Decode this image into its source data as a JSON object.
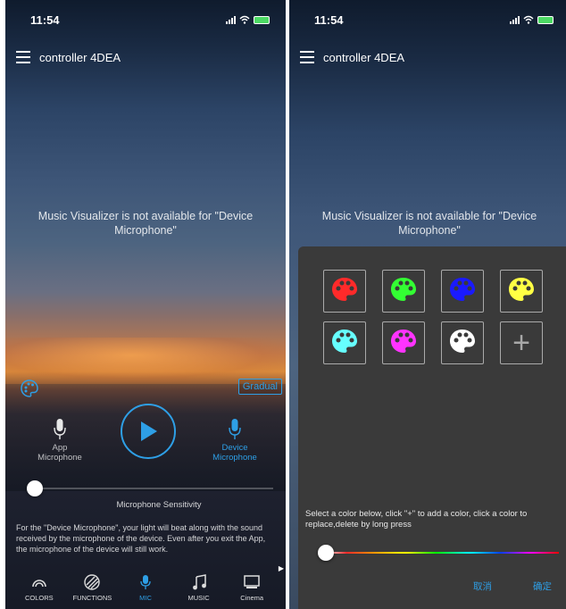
{
  "left": {
    "status": {
      "time": "11:54"
    },
    "title": "controller 4DEA",
    "notice": "Music Visualizer is not available for \"Device Microphone\"",
    "gradual_label": "Gradual",
    "app_mic": {
      "line1": "App",
      "line2": "Microphone"
    },
    "device_mic": {
      "line1": "Device",
      "line2": "Microphone"
    },
    "sensitivity_label": "Microphone Sensitivity",
    "sensitivity_value": 0,
    "explanation": "For the \"Device Microphone\", your light will beat along with the sound received by the microphone of the device. Even after you exit the App, the microphone of the device will still work.",
    "tabs": [
      {
        "label": "COLORS",
        "icon": "rainbow-icon",
        "active": false
      },
      {
        "label": "FUNCTIONS",
        "icon": "stripes-icon",
        "active": false
      },
      {
        "label": "MIC",
        "icon": "microphone-icon",
        "active": true
      },
      {
        "label": "MUSIC",
        "icon": "music-note-icon",
        "active": false
      },
      {
        "label": "Cinema",
        "icon": "screen-icon",
        "active": false
      }
    ],
    "accent_color": "#2e9fe6"
  },
  "right": {
    "status": {
      "time": "11:54"
    },
    "title": "controller 4DEA",
    "notice": "Music Visualizer is not available for \"Device Microphone\"",
    "palette_colors": [
      "#ff2a2a",
      "#33ff33",
      "#1a1aff",
      "#ffff44",
      "#66ffff",
      "#ff33ff",
      "#ffffff"
    ],
    "add_label": "+",
    "instruction": "Select a color below, click \"+\" to add a color, click a color to replace,delete by long press",
    "cancel_label": "取消",
    "confirm_label": "确定"
  }
}
